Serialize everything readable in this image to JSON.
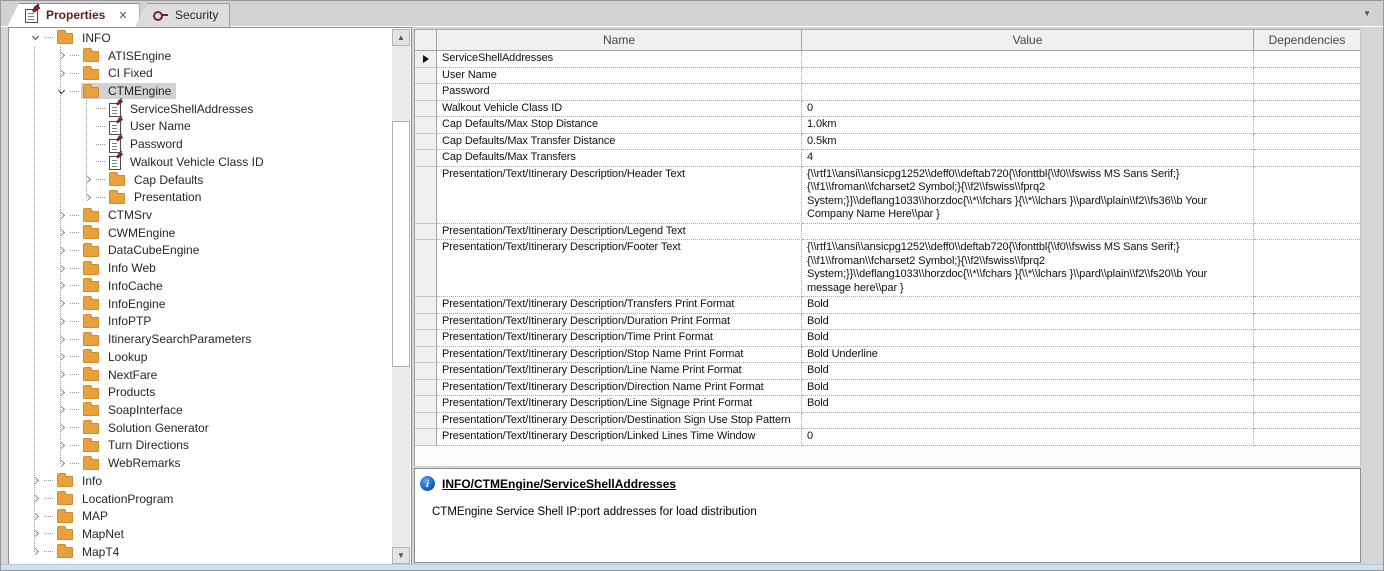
{
  "tabs": {
    "properties": {
      "label": "Properties",
      "close_glyph": "✕"
    },
    "security": {
      "label": "Security"
    },
    "dropdown_glyph": "▼"
  },
  "scrollbar": {
    "up_glyph": "▲",
    "down_glyph": "▼"
  },
  "tree": {
    "items": [
      {
        "label": "INFO",
        "level": 0,
        "type": "folder",
        "state": "expanded"
      },
      {
        "label": "ATISEngine",
        "level": 1,
        "type": "folder",
        "state": "collapsed"
      },
      {
        "label": "CI Fixed",
        "level": 1,
        "type": "folder",
        "state": "collapsed"
      },
      {
        "label": "CTMEngine",
        "level": 1,
        "type": "folder",
        "state": "expanded",
        "selected": true
      },
      {
        "label": "ServiceShellAddresses",
        "level": 2,
        "type": "leaf"
      },
      {
        "label": "User Name",
        "level": 2,
        "type": "leaf"
      },
      {
        "label": "Password",
        "level": 2,
        "type": "leaf"
      },
      {
        "label": "Walkout Vehicle Class ID",
        "level": 2,
        "type": "leaf"
      },
      {
        "label": "Cap Defaults",
        "level": 2,
        "type": "folder",
        "state": "collapsed"
      },
      {
        "label": "Presentation",
        "level": 2,
        "type": "folder",
        "state": "collapsed"
      },
      {
        "label": "CTMSrv",
        "level": 1,
        "type": "folder",
        "state": "collapsed"
      },
      {
        "label": "CWMEngine",
        "level": 1,
        "type": "folder",
        "state": "collapsed"
      },
      {
        "label": "DataCubeEngine",
        "level": 1,
        "type": "folder",
        "state": "collapsed"
      },
      {
        "label": "Info Web",
        "level": 1,
        "type": "folder",
        "state": "collapsed"
      },
      {
        "label": "InfoCache",
        "level": 1,
        "type": "folder",
        "state": "collapsed"
      },
      {
        "label": "InfoEngine",
        "level": 1,
        "type": "folder",
        "state": "collapsed"
      },
      {
        "label": "InfoPTP",
        "level": 1,
        "type": "folder",
        "state": "collapsed"
      },
      {
        "label": "ItinerarySearchParameters",
        "level": 1,
        "type": "folder",
        "state": "collapsed"
      },
      {
        "label": "Lookup",
        "level": 1,
        "type": "folder",
        "state": "collapsed"
      },
      {
        "label": "NextFare",
        "level": 1,
        "type": "folder",
        "state": "collapsed"
      },
      {
        "label": "Products",
        "level": 1,
        "type": "folder",
        "state": "collapsed"
      },
      {
        "label": "SoapInterface",
        "level": 1,
        "type": "folder",
        "state": "collapsed"
      },
      {
        "label": "Solution Generator",
        "level": 1,
        "type": "folder",
        "state": "collapsed"
      },
      {
        "label": "Turn Directions",
        "level": 1,
        "type": "folder",
        "state": "collapsed"
      },
      {
        "label": "WebRemarks",
        "level": 1,
        "type": "folder",
        "state": "collapsed"
      },
      {
        "label": "Info",
        "level": 0,
        "type": "folder",
        "state": "collapsed"
      },
      {
        "label": "LocationProgram",
        "level": 0,
        "type": "folder",
        "state": "collapsed"
      },
      {
        "label": "MAP",
        "level": 0,
        "type": "folder",
        "state": "collapsed"
      },
      {
        "label": "MapNet",
        "level": 0,
        "type": "folder",
        "state": "collapsed"
      },
      {
        "label": "MapT4",
        "level": 0,
        "type": "folder",
        "state": "collapsed"
      }
    ]
  },
  "grid": {
    "columns": {
      "name": "Name",
      "value": "Value",
      "dependencies": "Dependencies"
    },
    "rows": [
      {
        "name": "ServiceShellAddresses",
        "value": "",
        "dependencies": "",
        "selected": true
      },
      {
        "name": "User Name",
        "value": "",
        "dependencies": ""
      },
      {
        "name": "Password",
        "value": "",
        "dependencies": ""
      },
      {
        "name": "Walkout Vehicle Class ID",
        "value": "0",
        "dependencies": ""
      },
      {
        "name": "Cap Defaults/Max Stop Distance",
        "value": "1.0km",
        "dependencies": ""
      },
      {
        "name": "Cap Defaults/Max Transfer Distance",
        "value": "0.5km",
        "dependencies": ""
      },
      {
        "name": "Cap Defaults/Max Transfers",
        "value": "4",
        "dependencies": ""
      },
      {
        "name": "Presentation/Text/Itinerary Description/Header Text",
        "value": "{\\\\rtf1\\\\ansi\\\\ansicpg1252\\\\deff0\\\\deftab720{\\\\fonttbl{\\\\f0\\\\fswiss MS Sans Serif;}{\\\\f1\\\\froman\\\\fcharset2 Symbol;}{\\\\f2\\\\fswiss\\\\fprq2 System;}}\\\\deflang1033\\\\horzdoc{\\\\*\\\\fchars }{\\\\*\\\\lchars }\\\\pard\\\\plain\\\\f2\\\\fs36\\\\b Your Company Name Here\\\\par }",
        "dependencies": ""
      },
      {
        "name": "Presentation/Text/Itinerary Description/Legend Text",
        "value": "",
        "dependencies": ""
      },
      {
        "name": "Presentation/Text/Itinerary Description/Footer Text",
        "value": "{\\\\rtf1\\\\ansi\\\\ansicpg1252\\\\deff0\\\\deftab720{\\\\fonttbl{\\\\f0\\\\fswiss MS Sans Serif;}{\\\\f1\\\\froman\\\\fcharset2 Symbol;}{\\\\f2\\\\fswiss\\\\fprq2 System;}}\\\\deflang1033\\\\horzdoc{\\\\*\\\\fchars }{\\\\*\\\\lchars }\\\\pard\\\\plain\\\\f2\\\\fs20\\\\b Your message here\\\\par }",
        "dependencies": ""
      },
      {
        "name": "Presentation/Text/Itinerary Description/Transfers Print Format",
        "value": "Bold",
        "dependencies": ""
      },
      {
        "name": "Presentation/Text/Itinerary Description/Duration Print Format",
        "value": "Bold",
        "dependencies": ""
      },
      {
        "name": "Presentation/Text/Itinerary Description/Time Print Format",
        "value": "Bold",
        "dependencies": ""
      },
      {
        "name": "Presentation/Text/Itinerary Description/Stop Name Print Format",
        "value": "Bold Underline",
        "dependencies": ""
      },
      {
        "name": "Presentation/Text/Itinerary Description/Line Name Print Format",
        "value": "Bold",
        "dependencies": ""
      },
      {
        "name": "Presentation/Text/Itinerary Description/Direction Name Print Format",
        "value": "Bold",
        "dependencies": ""
      },
      {
        "name": "Presentation/Text/Itinerary Description/Line Signage Print Format",
        "value": "Bold",
        "dependencies": ""
      },
      {
        "name": "Presentation/Text/Itinerary Description/Destination Sign Use Stop Pattern",
        "value": "",
        "dependencies": ""
      },
      {
        "name": "Presentation/Text/Itinerary Description/Linked Lines Time Window",
        "value": "0",
        "dependencies": ""
      }
    ]
  },
  "infobox": {
    "title": "INFO/CTMEngine/ServiceShellAddresses",
    "info_glyph": "i",
    "description": "CTMEngine Service Shell IP:port addresses for load distribution"
  },
  "colors": {
    "folder": "#e9a23b",
    "selection": "#d2d2d2",
    "tab_active_text": "#5f2120",
    "info_icon": "#1257b8"
  }
}
